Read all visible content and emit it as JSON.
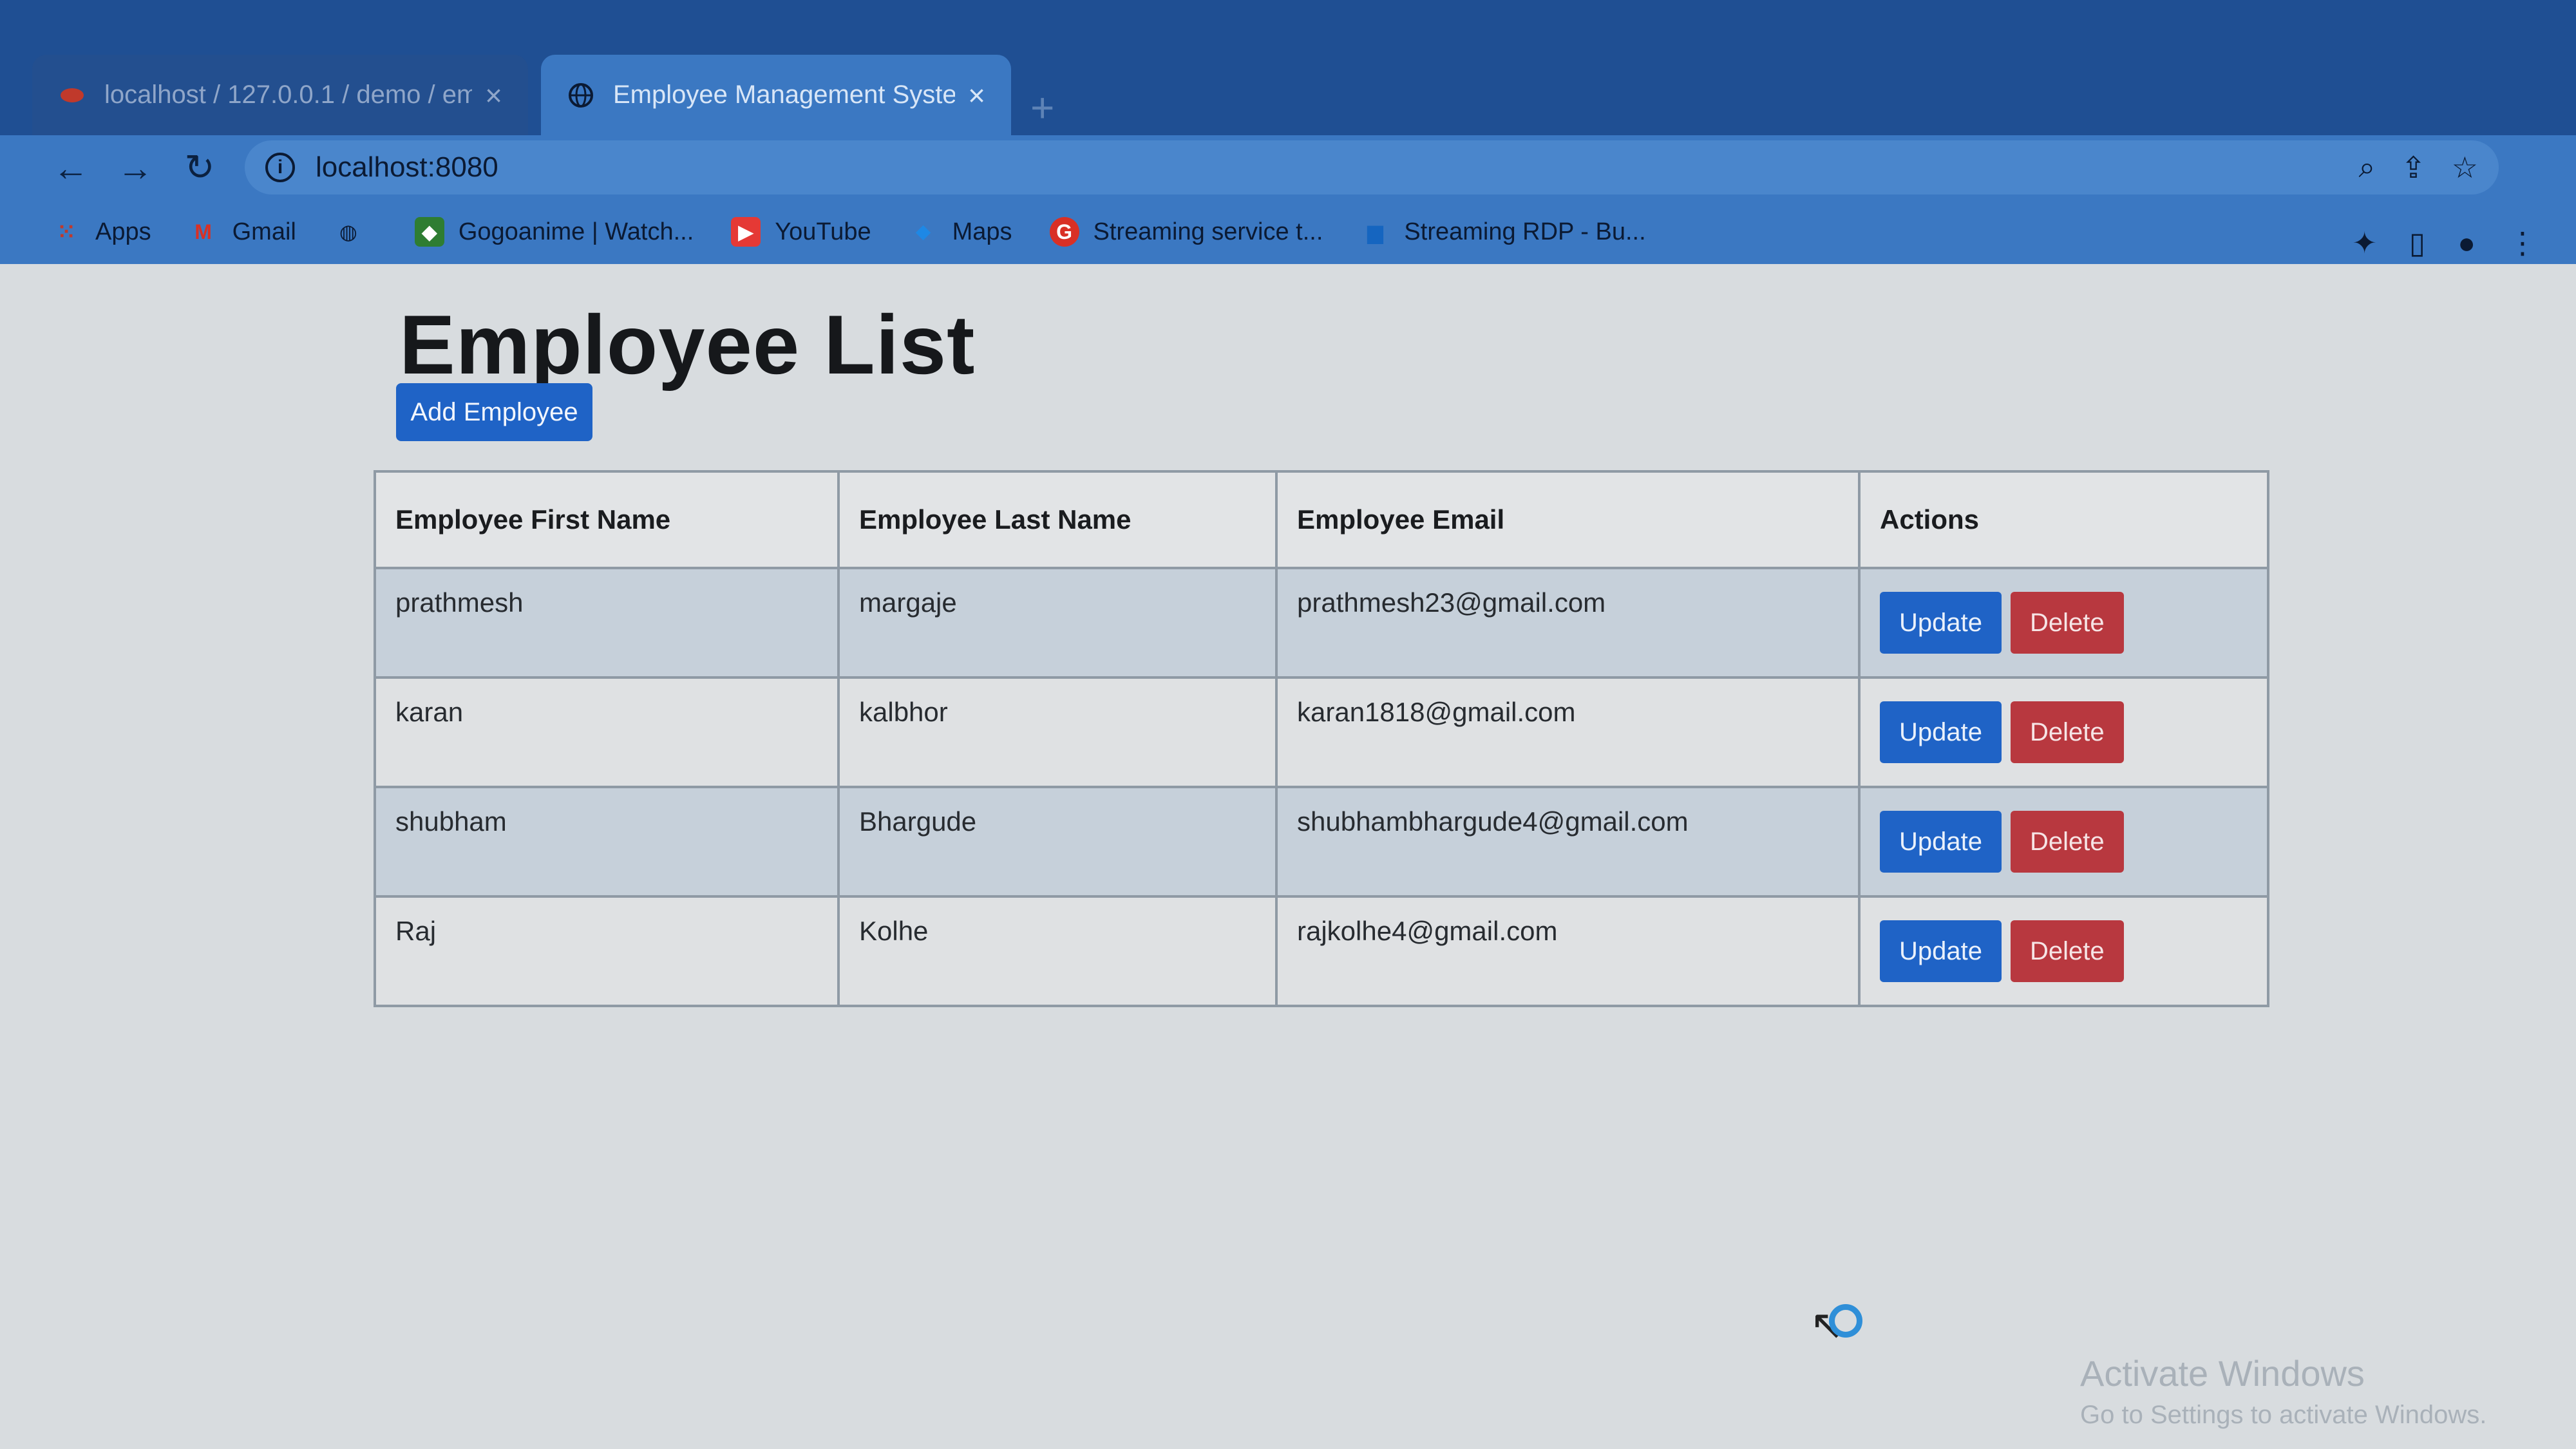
{
  "browser": {
    "tabs": [
      {
        "title": "localhost / 127.0.0.1 / demo / em",
        "active": false
      },
      {
        "title": "Employee Management System",
        "active": true
      }
    ],
    "new_tab": "+",
    "address": "localhost:8080",
    "bookmarks": [
      {
        "label": "Apps",
        "icon": "apps-grid-icon"
      },
      {
        "label": "Gmail",
        "icon": "gmail-icon"
      },
      {
        "label": "",
        "icon": "globe-icon"
      },
      {
        "label": "Gogoanime | Watch...",
        "icon": "gogoanime-icon"
      },
      {
        "label": "YouTube",
        "icon": "youtube-icon"
      },
      {
        "label": "Maps",
        "icon": "maps-icon"
      },
      {
        "label": "Streaming service t...",
        "icon": "google-icon"
      },
      {
        "label": "Streaming RDP - Bu...",
        "icon": "rdp-icon"
      }
    ]
  },
  "page": {
    "title": "Employee List",
    "add_button": "Add Employee",
    "columns": [
      "Employee First Name",
      "Employee Last Name",
      "Employee Email",
      "Actions"
    ],
    "rows": [
      {
        "first": "prathmesh",
        "last": "margaje",
        "email": "prathmesh23@gmail.com"
      },
      {
        "first": "karan",
        "last": "kalbhor",
        "email": "karan1818@gmail.com"
      },
      {
        "first": "shubham",
        "last": "Bhargude",
        "email": "shubhambhargude4@gmail.com"
      },
      {
        "first": "Raj",
        "last": "Kolhe",
        "email": "rajkolhe4@gmail.com"
      }
    ],
    "update_label": "Update",
    "delete_label": "Delete"
  },
  "watermark": {
    "title": "Activate Windows",
    "subtitle": "Go to Settings to activate Windows."
  },
  "colors": {
    "primary": "#1f63c6",
    "danger": "#b8383f",
    "browser_chrome": "#3b78c2"
  }
}
